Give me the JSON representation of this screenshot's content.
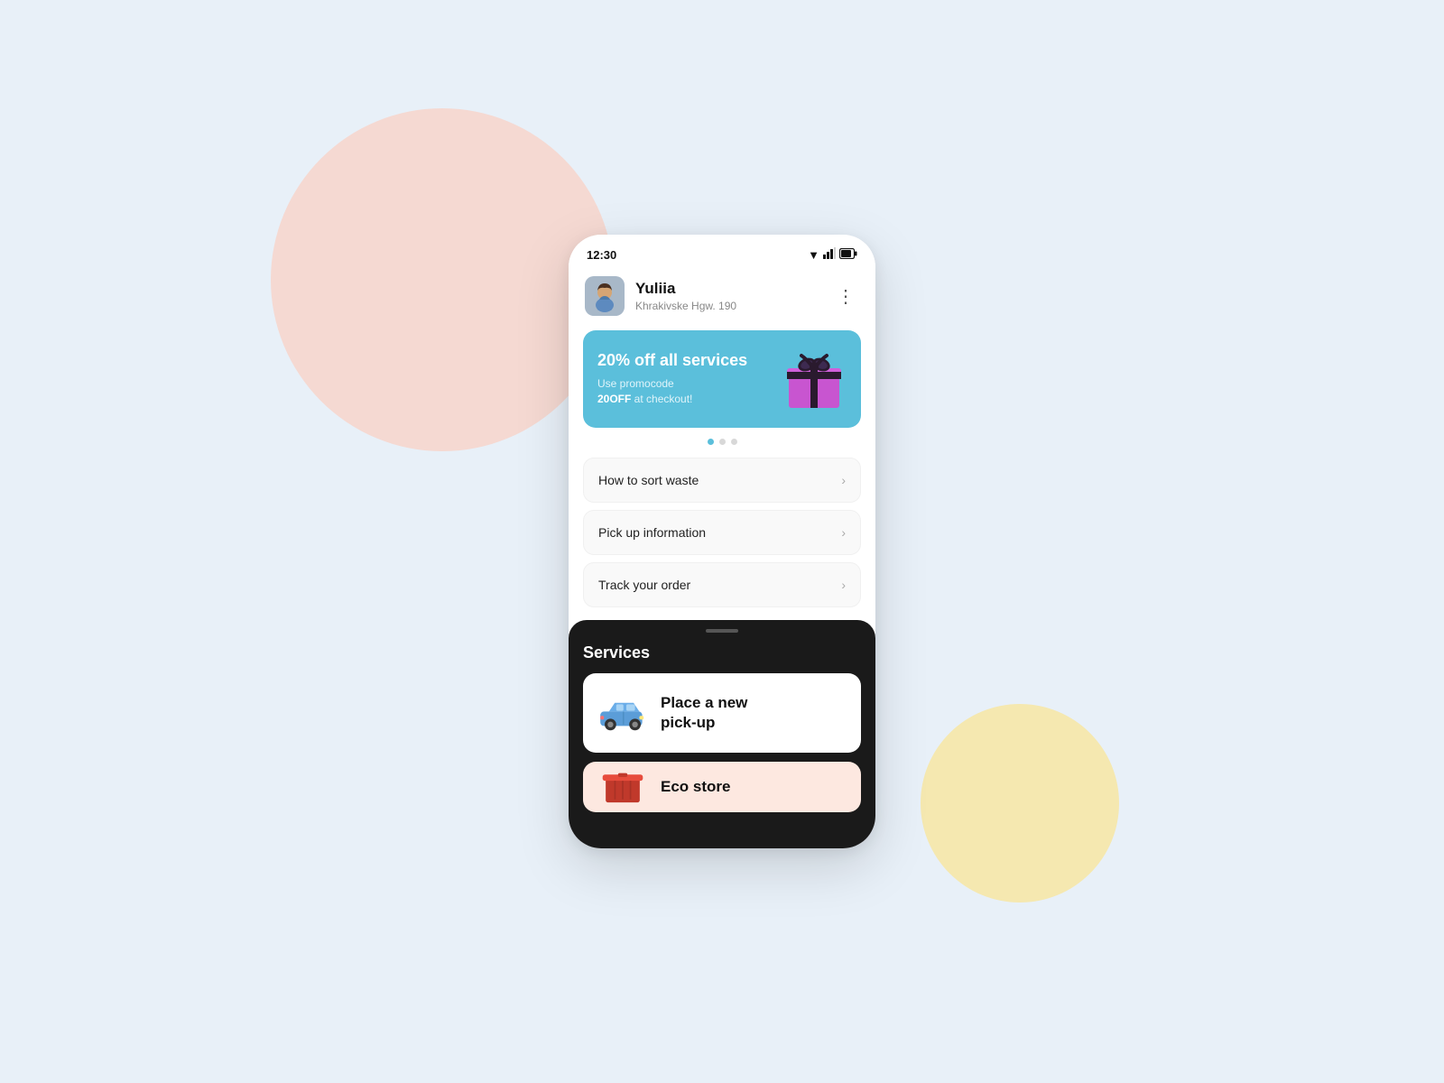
{
  "background": {
    "color": "#e8f0f8"
  },
  "statusBar": {
    "time": "12:30",
    "wifiIcon": "▼",
    "signalIcon": "▲",
    "batteryIcon": "▐"
  },
  "header": {
    "userName": "Yuliia",
    "userAddress": "Khrakivske Hgw. 190",
    "menuIcon": "⋮"
  },
  "promoBanner": {
    "title": "20% off all services",
    "subtitle": "Use promocode",
    "promoCode": "20OFF",
    "suffix": " at checkout!"
  },
  "dotsIndicator": [
    {
      "active": true
    },
    {
      "active": false
    },
    {
      "active": false
    }
  ],
  "menuItems": [
    {
      "label": "How to sort waste",
      "chevron": "›"
    },
    {
      "label": "Pick up information",
      "chevron": "›"
    },
    {
      "label": "Track your order",
      "chevron": "›"
    }
  ],
  "services": {
    "title": "Services",
    "cards": [
      {
        "label": "Place a new\npick-up",
        "iconType": "car",
        "bgColor": "#ffffff"
      },
      {
        "label": "Eco store",
        "iconType": "box",
        "bgColor": "#fde8e0"
      }
    ]
  }
}
